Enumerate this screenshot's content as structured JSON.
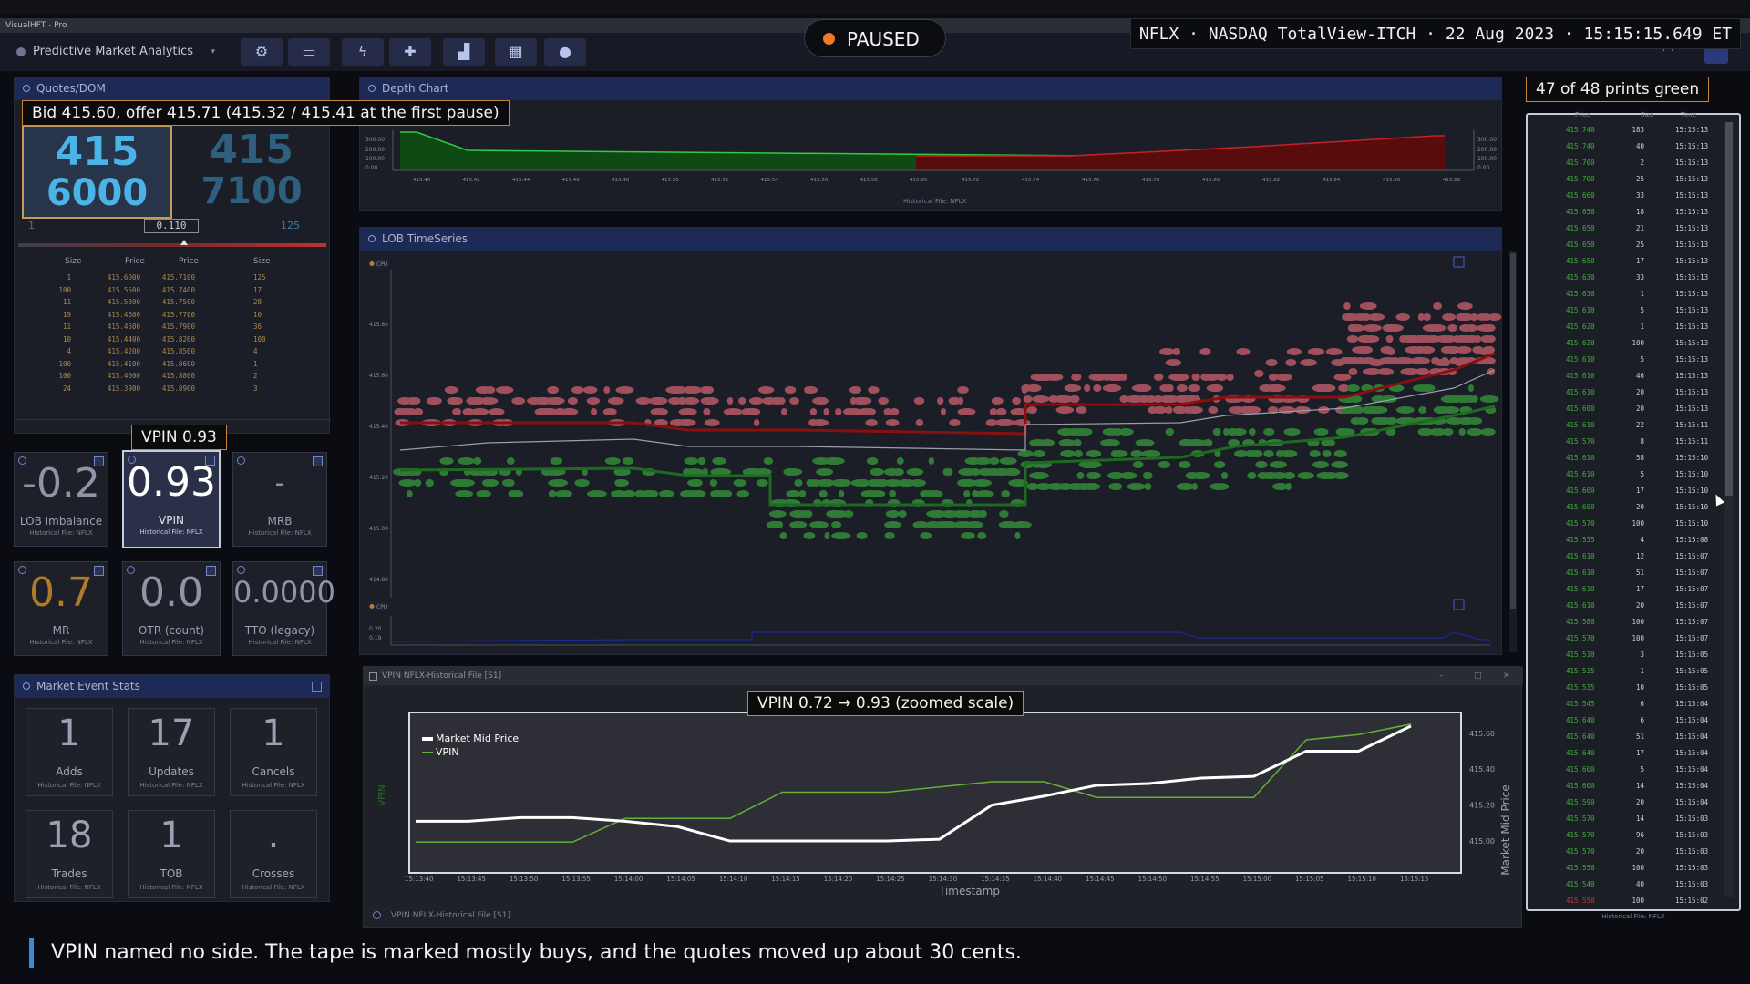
{
  "window_title": "VisualHFT - Pro",
  "paused_label": "PAUSED",
  "session_info": "NFLX · NASDAQ TotalView-ITCH · 22 Aug 2023 · 15:15:15.649 ET",
  "toolbar": {
    "module_select": "Predictive Market Analytics",
    "buttons": [
      "settings-icon",
      "monitor-icon",
      "bolt-icon",
      "puzzle-icon",
      "chart-icon",
      "keyboard-icon",
      "user-icon"
    ]
  },
  "quotes": {
    "title": "Quotes/DOM",
    "bid_price": "415",
    "bid_size": "6000",
    "ask_price": "415",
    "ask_size": "7100",
    "spread": "0.110",
    "left_small": "1",
    "right_small": "125",
    "columns": [
      "Size",
      "Price",
      "Price",
      "Size"
    ],
    "rows": [
      [
        "1",
        "415.6000",
        "415.7100",
        "125"
      ],
      [
        "100",
        "415.5500",
        "415.7400",
        "17"
      ],
      [
        "11",
        "415.5300",
        "415.7500",
        "28"
      ],
      [
        "19",
        "415.4600",
        "415.7700",
        "10"
      ],
      [
        "11",
        "415.4500",
        "415.7900",
        "36"
      ],
      [
        "10",
        "415.4400",
        "415.8200",
        "100"
      ],
      [
        "4",
        "415.4200",
        "415.8500",
        "4"
      ],
      [
        "100",
        "415.4100",
        "415.8600",
        "1"
      ],
      [
        "100",
        "415.4000",
        "415.8800",
        "2"
      ],
      [
        "24",
        "415.3900",
        "415.8900",
        "3"
      ]
    ]
  },
  "annotations": {
    "quotes": "Bid 415.60, offer 415.71 (415.32 / 415.41 at the first pause)",
    "vpin": "VPIN 0.93",
    "tape": "47 of 48 prints green",
    "chart": "VPIN 0.72 → 0.93 (zoomed scale)",
    "caption": "VPIN named no side. The tape is marked mostly buys, and the quotes moved up about 30 cents."
  },
  "tiles": [
    {
      "value": "-0.2",
      "label": "LOB Imbalance",
      "sub": "Historical File: NFLX",
      "color": "#8f95a6"
    },
    {
      "value": "0.93",
      "label": "VPIN",
      "sub": "Historical File: NFLX",
      "color": "#ffffff"
    },
    {
      "value": "-",
      "label": "MRB",
      "sub": "Historical File: NFLX",
      "color": "#8f95a6"
    },
    {
      "value": "0.7",
      "label": "MR",
      "sub": "Historical File: NFLX",
      "color": "#b07a2a"
    },
    {
      "value": "0.0",
      "label": "OTR (count)",
      "sub": "Historical File: NFLX",
      "color": "#8f95a6"
    },
    {
      "value": "0.0000",
      "label": "TTO (legacy)",
      "sub": "Historical File: NFLX",
      "color": "#8f95a6"
    }
  ],
  "market_stats": {
    "title": "Market Event Stats",
    "items": [
      {
        "value": "1",
        "label": "Adds",
        "sub": "Historical File: NFLX"
      },
      {
        "value": "17",
        "label": "Updates",
        "sub": "Historical File: NFLX"
      },
      {
        "value": "1",
        "label": "Cancels",
        "sub": "Historical File: NFLX"
      },
      {
        "value": "18",
        "label": "Trades",
        "sub": "Historical File: NFLX"
      },
      {
        "value": "1",
        "label": "TOB",
        "sub": "Historical File: NFLX"
      },
      {
        "value": ".",
        "label": "Crosses",
        "sub": "Historical File: NFLX"
      }
    ]
  },
  "depth_chart": {
    "title": "Depth Chart",
    "footer": "Historical File: NFLX",
    "y_ticks": [
      "300.00",
      "200.00",
      "100.00",
      "0.00"
    ],
    "x_ticks": [
      "415.40",
      "415.42",
      "415.44",
      "415.46",
      "415.48",
      "415.50",
      "415.52",
      "415.54",
      "415.56",
      "415.58",
      "415.60",
      "415.72",
      "415.74",
      "415.76",
      "415.78",
      "415.80",
      "415.82",
      "415.84",
      "415.86",
      "415.88"
    ]
  },
  "lob_timeseries": {
    "title": "LOB TimeSeries",
    "tag_top": "CPU",
    "tag_bottom": "CPU",
    "y_ticks": [
      "415.80",
      "415.60",
      "415.40",
      "415.20",
      "415.00",
      "414.80"
    ],
    "y_ticks_bottom": [
      "0.20",
      "0.19"
    ]
  },
  "vpin_window": {
    "title": "VPIN NFLX-Historical File [S1]",
    "footer": "VPIN NFLX-Historical File [S1]"
  },
  "chart_data": {
    "type": "line",
    "xlabel": "Timestamp",
    "ylabel_right": "Market Mid Price",
    "ylabel_left": "VPIN",
    "x": [
      "15:13:40",
      "15:13:45",
      "15:13:50",
      "15:13:55",
      "15:14:00",
      "15:14:05",
      "15:14:10",
      "15:14:15",
      "15:14:20",
      "15:14:25",
      "15:14:30",
      "15:14:35",
      "15:14:40",
      "15:14:45",
      "15:14:50",
      "15:14:55",
      "15:15:00",
      "15:15:05",
      "15:15:10",
      "15:15:15"
    ],
    "y_right_ticks": [
      "415.60",
      "415.40",
      "415.20",
      "415.00"
    ],
    "ylim_right": [
      414.98,
      415.68
    ],
    "ylim_left": [
      0.7,
      0.94
    ],
    "series": [
      {
        "name": "Market Mid Price",
        "color": "#ffffff",
        "values": [
          415.11,
          415.11,
          415.13,
          415.13,
          415.11,
          415.08,
          415.0,
          415.0,
          415.0,
          415.0,
          415.01,
          415.2,
          415.25,
          415.31,
          415.32,
          415.35,
          415.36,
          415.5,
          415.5,
          415.64
        ]
      },
      {
        "name": "VPIN",
        "color": "#66b035",
        "values": [
          0.705,
          0.705,
          0.705,
          0.705,
          0.75,
          0.75,
          0.75,
          0.8,
          0.8,
          0.8,
          0.81,
          0.82,
          0.82,
          0.79,
          0.79,
          0.79,
          0.79,
          0.9,
          0.91,
          0.93
        ]
      }
    ],
    "legend": "top-left"
  },
  "tape": {
    "columns": [
      "Price",
      "Size",
      "Time"
    ],
    "footer": "Historical File: NFLX",
    "rows": [
      [
        "415.740",
        "183",
        "15:15:13"
      ],
      [
        "415.740",
        "40",
        "15:15:13"
      ],
      [
        "415.700",
        "2",
        "15:15:13"
      ],
      [
        "415.700",
        "25",
        "15:15:13"
      ],
      [
        "415.660",
        "33",
        "15:15:13"
      ],
      [
        "415.650",
        "18",
        "15:15:13"
      ],
      [
        "415.650",
        "21",
        "15:15:13"
      ],
      [
        "415.650",
        "25",
        "15:15:13"
      ],
      [
        "415.650",
        "17",
        "15:15:13"
      ],
      [
        "415.630",
        "33",
        "15:15:13"
      ],
      [
        "415.630",
        "1",
        "15:15:13"
      ],
      [
        "415.610",
        "5",
        "15:15:13"
      ],
      [
        "415.620",
        "1",
        "15:15:13"
      ],
      [
        "415.620",
        "100",
        "15:15:13"
      ],
      [
        "415.610",
        "5",
        "15:15:13"
      ],
      [
        "415.610",
        "46",
        "15:15:13"
      ],
      [
        "415.610",
        "20",
        "15:15:13"
      ],
      [
        "415.600",
        "20",
        "15:15:13"
      ],
      [
        "415.610",
        "22",
        "15:15:11"
      ],
      [
        "415.570",
        "8",
        "15:15:11"
      ],
      [
        "415.610",
        "58",
        "15:15:10"
      ],
      [
        "415.610",
        "5",
        "15:15:10"
      ],
      [
        "415.600",
        "17",
        "15:15:10"
      ],
      [
        "415.600",
        "20",
        "15:15:10"
      ],
      [
        "415.570",
        "100",
        "15:15:10"
      ],
      [
        "415.535",
        "4",
        "15:15:08"
      ],
      [
        "415.610",
        "12",
        "15:15:07"
      ],
      [
        "415.610",
        "51",
        "15:15:07"
      ],
      [
        "415.610",
        "17",
        "15:15:07"
      ],
      [
        "415.610",
        "20",
        "15:15:07"
      ],
      [
        "415.580",
        "100",
        "15:15:07"
      ],
      [
        "415.570",
        "100",
        "15:15:07"
      ],
      [
        "415.510",
        "3",
        "15:15:05"
      ],
      [
        "415.535",
        "1",
        "15:15:05"
      ],
      [
        "415.535",
        "10",
        "15:15:05"
      ],
      [
        "415.545",
        "6",
        "15:15:04"
      ],
      [
        "415.640",
        "6",
        "15:15:04"
      ],
      [
        "415.640",
        "51",
        "15:15:04"
      ],
      [
        "415.640",
        "17",
        "15:15:04"
      ],
      [
        "415.600",
        "5",
        "15:15:04"
      ],
      [
        "415.600",
        "14",
        "15:15:04"
      ],
      [
        "415.590",
        "20",
        "15:15:04"
      ],
      [
        "415.570",
        "14",
        "15:15:03"
      ],
      [
        "415.570",
        "96",
        "15:15:03"
      ],
      [
        "415.570",
        "20",
        "15:15:03"
      ],
      [
        "415.550",
        "100",
        "15:15:03"
      ],
      [
        "415.540",
        "40",
        "15:15:03"
      ],
      [
        "415.550",
        "100",
        "15:15:02"
      ]
    ],
    "colors": {
      "buy": "#3fae3a",
      "sell": "#d03030"
    }
  }
}
